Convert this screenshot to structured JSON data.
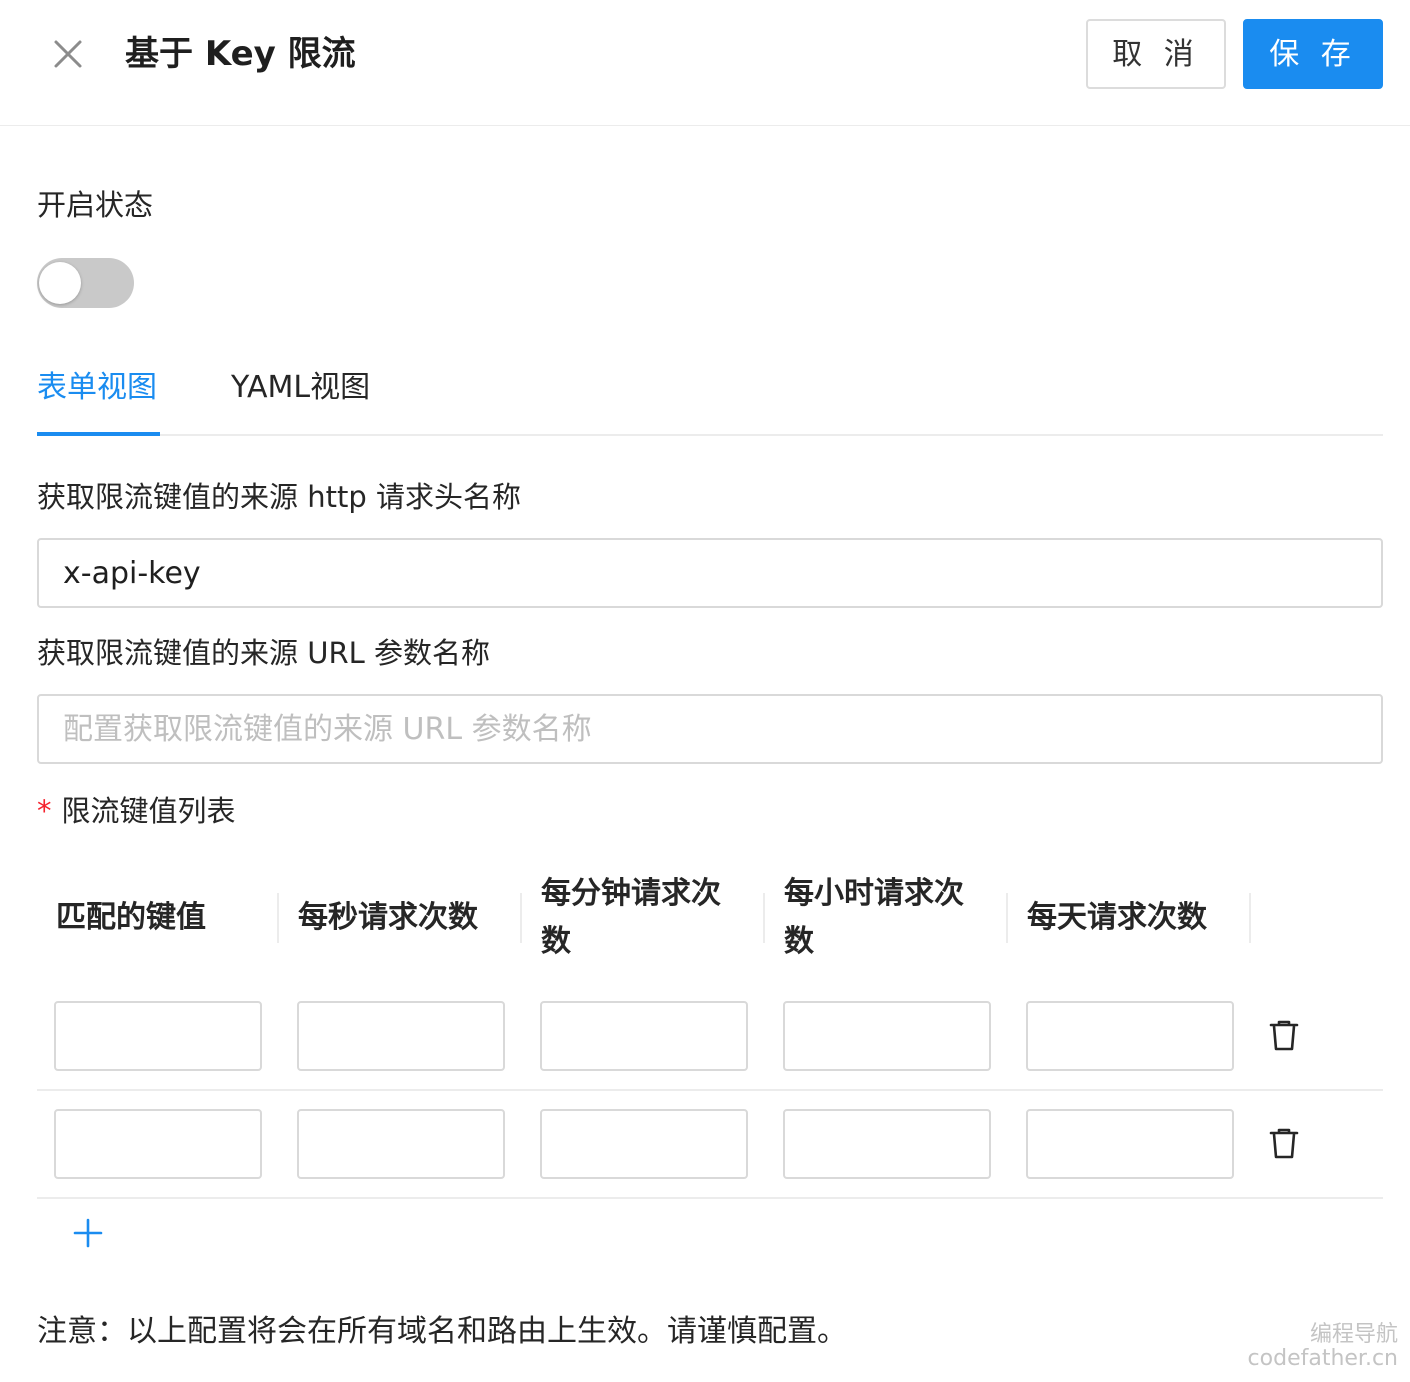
{
  "header": {
    "title": "基于 Key 限流",
    "cancel_label": "取 消",
    "save_label": "保 存",
    "close_icon": "close-icon"
  },
  "status": {
    "label": "开启状态",
    "enabled": false
  },
  "tabs": [
    {
      "label": "表单视图",
      "active": true
    },
    {
      "label": "YAML视图",
      "active": false
    }
  ],
  "form": {
    "header_source_label": "获取限流键值的来源 http 请求头名称",
    "header_source_value": "x-api-key",
    "url_source_label": "获取限流键值的来源 URL 参数名称",
    "url_source_placeholder": "配置获取限流键值的来源 URL 参数名称",
    "url_source_value": "",
    "list_required_mark": "*",
    "list_label": "限流键值列表"
  },
  "table": {
    "columns": [
      {
        "line1": "匹配的键值",
        "line2": ""
      },
      {
        "line1": "每秒请求次数",
        "line2": ""
      },
      {
        "line1": "每分钟请求次",
        "line2": "数"
      },
      {
        "line1": "每小时请求次",
        "line2": "数"
      },
      {
        "line1": "每天请求次数",
        "line2": ""
      }
    ],
    "rows": [
      [
        "",
        "",
        "",
        "",
        ""
      ],
      [
        "",
        "",
        "",
        "",
        ""
      ]
    ],
    "row_action_icon": "trash-icon",
    "add_icon": "plus-icon"
  },
  "note": "注意：以上配置将会在所有域名和路由上生效。请谨慎配置。",
  "watermark": {
    "line1": "编程导航",
    "line2": "codefather.cn"
  },
  "colors": {
    "primary": "#1a8cf0",
    "border": "#d9d9d9",
    "divider": "#ececec",
    "required": "#f5222d",
    "toggle_off": "#c9c9c9"
  }
}
